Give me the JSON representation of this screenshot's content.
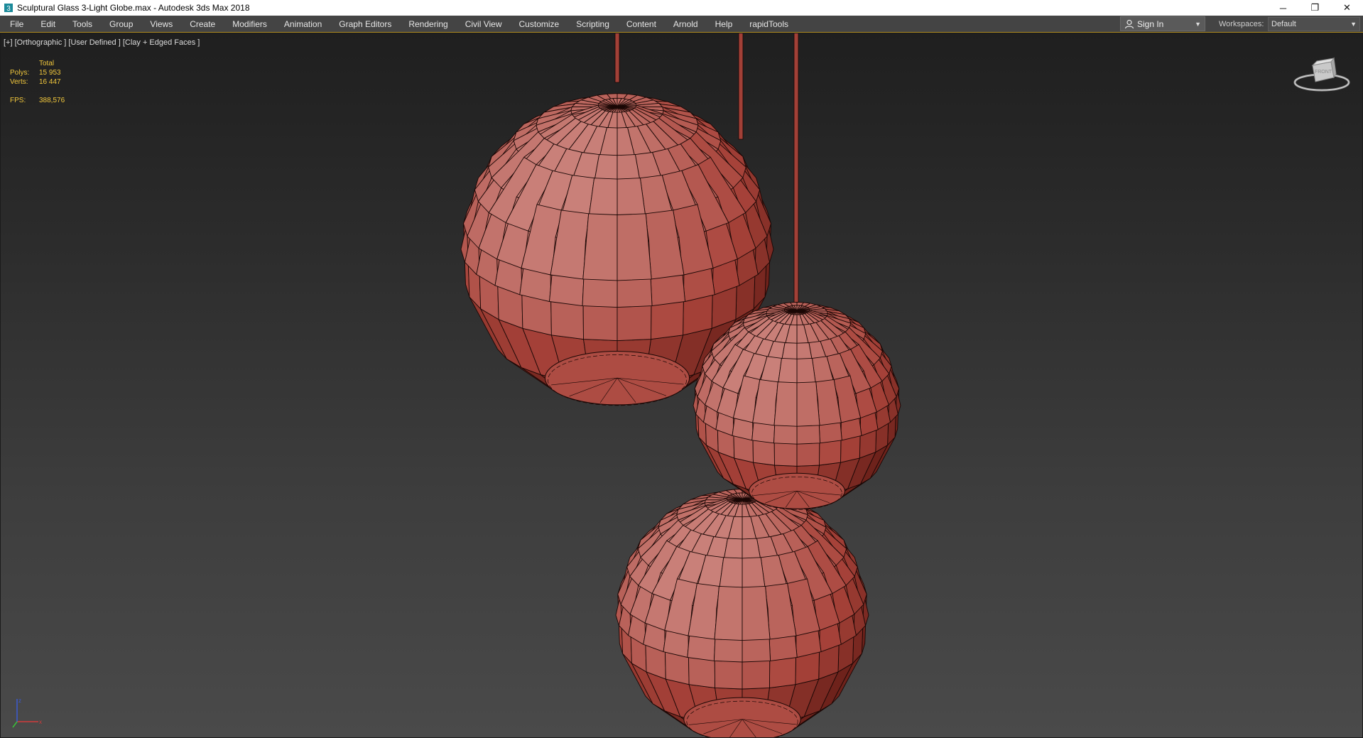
{
  "window": {
    "title": "Sculptural Glass 3-Light Globe.max - Autodesk 3ds Max 2018",
    "controls": {
      "minimize": "─",
      "restore": "❐",
      "close": "✕"
    }
  },
  "menu": {
    "items": [
      "File",
      "Edit",
      "Tools",
      "Group",
      "Views",
      "Create",
      "Modifiers",
      "Animation",
      "Graph Editors",
      "Rendering",
      "Civil View",
      "Customize",
      "Scripting",
      "Content",
      "Arnold",
      "Help",
      "rapidTools"
    ]
  },
  "account": {
    "sign_in": "Sign In"
  },
  "workspaces": {
    "label": "Workspaces:",
    "value": "Default"
  },
  "viewport": {
    "label": "[+] [Orthographic ] [User Defined ] [Clay + Edged Faces ]",
    "stats": {
      "header": "Total",
      "polys_label": "Polys:",
      "polys_value": "15 953",
      "verts_label": "Verts:",
      "verts_value": "16 447",
      "fps_label": "FPS:",
      "fps_value": "388,576"
    },
    "viewcube_face": "FRONT"
  },
  "colors": {
    "clay": "#a8433a",
    "clay_light": "#c98079",
    "clay_dark": "#6e221b",
    "edge": "#1a0705",
    "stats_text": "#f2c83c"
  },
  "icons": [
    "app-3dsmax-icon",
    "user-icon",
    "dropdown-arrow-icon",
    "viewcube-icon",
    "axis-tripod-icon"
  ]
}
